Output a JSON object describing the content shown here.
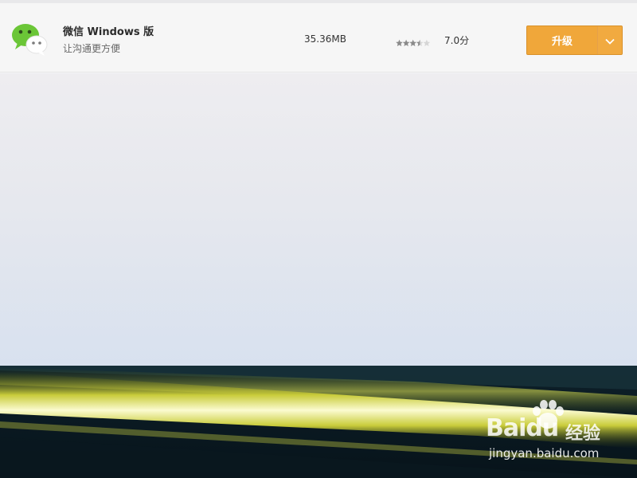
{
  "app": {
    "name": "微信 Windows 版",
    "description": "让沟通更方便",
    "size": "35.36MB",
    "rating_fraction": 0.7,
    "score": "7.0分",
    "icon": "wechat-icon"
  },
  "actions": {
    "upgrade_label": "升级",
    "dropdown_icon": "chevron-down-icon"
  },
  "colors": {
    "accent": "#f0a73a",
    "wechat_green": "#6bc637"
  },
  "watermark": {
    "brand_bai": "Bai",
    "brand_du": "du",
    "brand_suffix": "经验",
    "url": "jingyan.baidu.com"
  }
}
